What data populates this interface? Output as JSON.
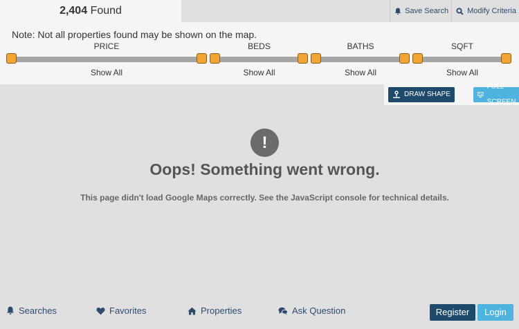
{
  "header": {
    "found_count": "2,404",
    "found_label": "Found",
    "save_search": "Save Search",
    "modify_criteria": "Modify Criteria"
  },
  "filters": {
    "note": "Note: Not all properties found may be shown on the map.",
    "sliders": [
      {
        "title": "PRICE",
        "value": "Show All"
      },
      {
        "title": "BEDS",
        "value": "Show All"
      },
      {
        "title": "BATHS",
        "value": "Show All"
      },
      {
        "title": "SQFT",
        "value": "Show All"
      }
    ]
  },
  "map": {
    "draw_shape": "DRAW SHAPE",
    "full_screen": "FULL SCREEN",
    "error_icon": "!",
    "error_title": "Oops! Something went wrong.",
    "error_text": "This page didn't load Google Maps correctly. See the JavaScript console for technical details."
  },
  "bottom_nav": {
    "searches": "Searches",
    "favorites": "Favorites",
    "properties": "Properties",
    "ask_question": "Ask Question",
    "register": "Register",
    "login": "Login"
  },
  "colors": {
    "primary": "#1d4a6b",
    "accent": "#4eb3de",
    "slider_handle": "#f1a534"
  }
}
